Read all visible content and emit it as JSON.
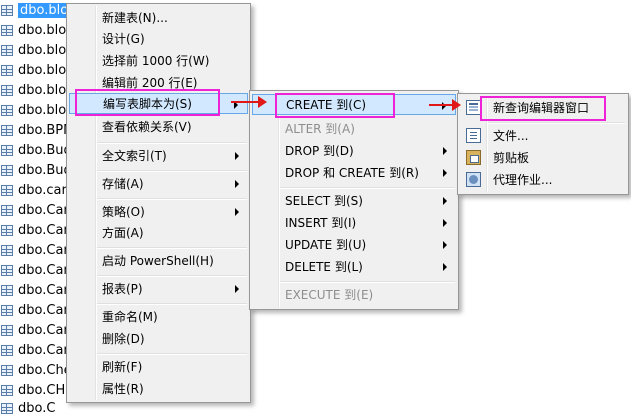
{
  "tree": {
    "items": [
      "dbo.blo",
      "dbo.blo",
      "dbo.blo",
      "dbo.blo",
      "dbo.blo",
      "dbo.blo",
      "dbo.BPM",
      "dbo.Bud",
      "dbo.Bud",
      "dbo.car",
      "dbo.Car",
      "dbo.Car",
      "dbo.Car",
      "dbo.Car",
      "dbo.Car",
      "dbo.Car",
      "dbo.Car",
      "dbo.Car",
      "dbo.Che",
      "dbo.CHI",
      "dbo.C"
    ]
  },
  "context_menu": {
    "items": [
      {
        "label": "新建表(N)...",
        "submenu": false
      },
      {
        "label": "设计(G)",
        "submenu": false
      },
      {
        "label": "选择前 1000 行(W)",
        "submenu": false
      },
      {
        "label": "编辑前 200 行(E)",
        "submenu": false
      },
      {
        "label": "编写表脚本为(S)",
        "submenu": true
      },
      {
        "label": "查看依赖关系(V)",
        "submenu": false
      },
      {
        "label": "全文索引(T)",
        "submenu": true
      },
      {
        "label": "存储(A)",
        "submenu": true
      },
      {
        "label": "策略(O)",
        "submenu": true
      },
      {
        "label": "方面(A)",
        "submenu": false
      },
      {
        "label": "启动 PowerShell(H)",
        "submenu": false
      },
      {
        "label": "报表(P)",
        "submenu": true
      },
      {
        "label": "重命名(M)",
        "submenu": false
      },
      {
        "label": "删除(D)",
        "submenu": false
      },
      {
        "label": "刷新(F)",
        "submenu": false
      },
      {
        "label": "属性(R)",
        "submenu": false
      }
    ]
  },
  "script_submenu": {
    "items": [
      {
        "label": "CREATE 到(C)",
        "submenu": true,
        "enabled": true
      },
      {
        "label": "ALTER 到(A)",
        "submenu": false,
        "enabled": false
      },
      {
        "label": "DROP 到(D)",
        "submenu": true,
        "enabled": true
      },
      {
        "label": "DROP 和 CREATE 到(R)",
        "submenu": true,
        "enabled": true
      },
      {
        "label": "SELECT 到(S)",
        "submenu": true,
        "enabled": true
      },
      {
        "label": "INSERT 到(I)",
        "submenu": true,
        "enabled": true
      },
      {
        "label": "UPDATE 到(U)",
        "submenu": true,
        "enabled": true
      },
      {
        "label": "DELETE 到(L)",
        "submenu": true,
        "enabled": true
      },
      {
        "label": "EXECUTE 到(E)",
        "submenu": false,
        "enabled": false
      }
    ]
  },
  "create_submenu": {
    "items": [
      {
        "label": "新查询编辑器窗口",
        "icon": "query-window-icon"
      },
      {
        "label": "文件...",
        "icon": "file-icon"
      },
      {
        "label": "剪贴板",
        "icon": "clipboard-icon"
      },
      {
        "label": "代理作业...",
        "icon": "agent-job-icon"
      }
    ]
  },
  "colors": {
    "highlight_box": "#ee22d6",
    "arrow": "#e01818",
    "hover_bg": "#d1e8ff",
    "tree_selection": "#3399ff"
  }
}
